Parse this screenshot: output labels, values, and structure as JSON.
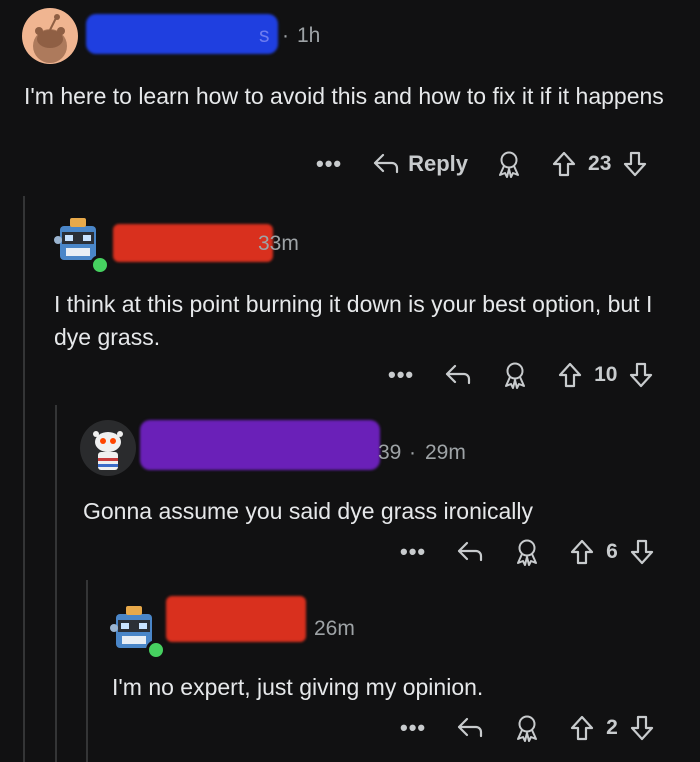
{
  "comments": [
    {
      "username_fragment": "s",
      "time": "1h",
      "body": "I'm here to learn how to avoid this and how to fix it if it happens",
      "reply_label": "Reply",
      "votes": "23",
      "redaction_color": "#1f3fe0"
    },
    {
      "username_fragment": "",
      "time": "33m",
      "body": "I think at this point burning it down is your best option, but I dye grass.",
      "votes": "10",
      "redaction_color": "#d9301e"
    },
    {
      "username_fragment": "39",
      "time": "29m",
      "body": "Gonna assume you said dye grass ironically",
      "votes": "6",
      "redaction_color": "#6a20b8"
    },
    {
      "username_fragment": "",
      "time": "26m",
      "body": "I'm no expert, just giving my opinion.",
      "votes": "2",
      "redaction_color": "#d9301e"
    }
  ],
  "ui": {
    "separator": "·",
    "more_dots": "•••"
  },
  "colors": {
    "background": "#111112",
    "thread_line": "#343536",
    "online": "#46d160"
  }
}
